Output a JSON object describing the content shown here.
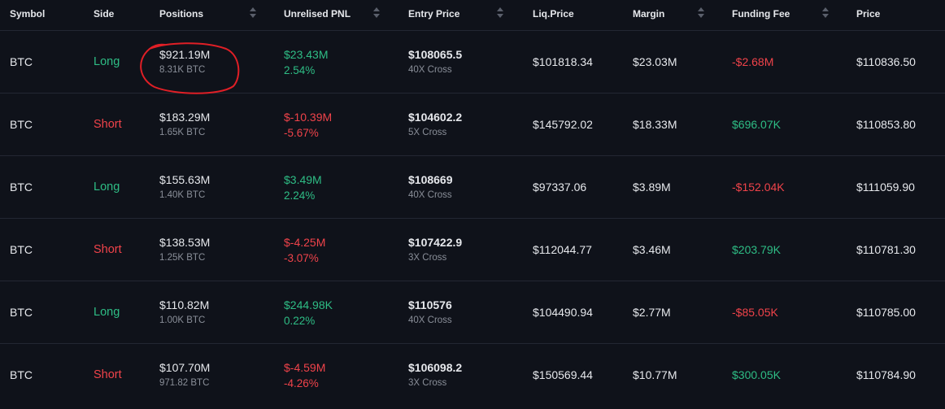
{
  "columns": {
    "symbol": "Symbol",
    "side": "Side",
    "positions": "Positions",
    "unrealised_pnl": "Unrelised PNL",
    "entry_price": "Entry Price",
    "liq_price": "Liq.Price",
    "margin": "Margin",
    "funding_fee": "Funding Fee",
    "price": "Price"
  },
  "colors": {
    "positive": "#2ebd85",
    "negative": "#f0434a",
    "annotation": "#e01f26"
  },
  "rows": [
    {
      "symbol": "BTC",
      "side": "Long",
      "side_type": "long",
      "position_usd": "$921.19M",
      "position_btc": "8.31K BTC",
      "pnl": "$23.43M",
      "pnl_pct": "2.54%",
      "pnl_type": "positive",
      "entry": "$108065.5",
      "leverage": "40X Cross",
      "liq": "$101818.34",
      "margin": "$23.03M",
      "funding": "-$2.68M",
      "funding_type": "negative",
      "price": "$110836.50"
    },
    {
      "symbol": "BTC",
      "side": "Short",
      "side_type": "short",
      "position_usd": "$183.29M",
      "position_btc": "1.65K BTC",
      "pnl": "$-10.39M",
      "pnl_pct": "-5.67%",
      "pnl_type": "negative",
      "entry": "$104602.2",
      "leverage": "5X Cross",
      "liq": "$145792.02",
      "margin": "$18.33M",
      "funding": "$696.07K",
      "funding_type": "positive",
      "price": "$110853.80"
    },
    {
      "symbol": "BTC",
      "side": "Long",
      "side_type": "long",
      "position_usd": "$155.63M",
      "position_btc": "1.40K BTC",
      "pnl": "$3.49M",
      "pnl_pct": "2.24%",
      "pnl_type": "positive",
      "entry": "$108669",
      "leverage": "40X Cross",
      "liq": "$97337.06",
      "margin": "$3.89M",
      "funding": "-$152.04K",
      "funding_type": "negative",
      "price": "$111059.90"
    },
    {
      "symbol": "BTC",
      "side": "Short",
      "side_type": "short",
      "position_usd": "$138.53M",
      "position_btc": "1.25K BTC",
      "pnl": "$-4.25M",
      "pnl_pct": "-3.07%",
      "pnl_type": "negative",
      "entry": "$107422.9",
      "leverage": "3X Cross",
      "liq": "$112044.77",
      "margin": "$3.46M",
      "funding": "$203.79K",
      "funding_type": "positive",
      "price": "$110781.30"
    },
    {
      "symbol": "BTC",
      "side": "Long",
      "side_type": "long",
      "position_usd": "$110.82M",
      "position_btc": "1.00K BTC",
      "pnl": "$244.98K",
      "pnl_pct": "0.22%",
      "pnl_type": "positive",
      "entry": "$110576",
      "leverage": "40X Cross",
      "liq": "$104490.94",
      "margin": "$2.77M",
      "funding": "-$85.05K",
      "funding_type": "negative",
      "price": "$110785.00"
    },
    {
      "symbol": "BTC",
      "side": "Short",
      "side_type": "short",
      "position_usd": "$107.70M",
      "position_btc": "971.82 BTC",
      "pnl": "$-4.59M",
      "pnl_pct": "-4.26%",
      "pnl_type": "negative",
      "entry": "$106098.2",
      "leverage": "3X Cross",
      "liq": "$150569.44",
      "margin": "$10.77M",
      "funding": "$300.05K",
      "funding_type": "positive",
      "price": "$110784.90"
    }
  ]
}
